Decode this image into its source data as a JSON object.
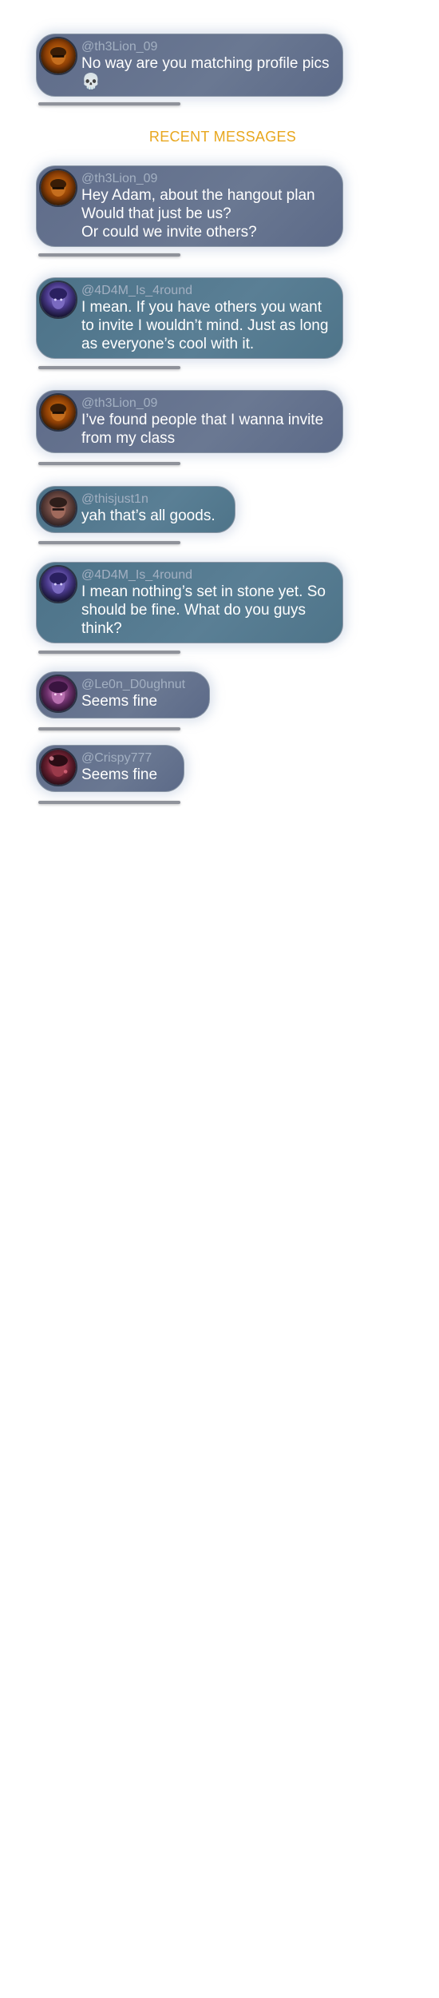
{
  "pinned": {
    "username": "@th3Lion_09",
    "text": "No way are you matching profile pics 💀",
    "avatar": "lion-avatar-icon"
  },
  "section_header": "RECENT MESSAGES",
  "messages": [
    {
      "username": "@th3Lion_09",
      "text": "Hey Adam, about the hangout plan\nWould that just be us?\nOr could we invite others?",
      "avatar": "lion-avatar-icon"
    },
    {
      "username": "@4D4M_Is_4round",
      "text": "I mean. If you have others you want to invite I wouldn’t mind. Just as long as everyone’s cool with it.",
      "avatar": "adam-avatar-icon"
    },
    {
      "username": "@th3Lion_09",
      "text": "I’ve found people that I wanna invite from my class",
      "avatar": "lion-avatar-icon"
    },
    {
      "username": "@thisjust1n",
      "text": "yah that’s all goods.",
      "avatar": "justin-avatar-icon"
    },
    {
      "username": "@4D4M_Is_4round",
      "text": "I mean nothing’s set in stone yet. So should be fine. What do you guys think?",
      "avatar": "adam-avatar-icon"
    },
    {
      "username": "@Le0n_D0ughnut",
      "text": "Seems fine",
      "avatar": "leon-avatar-icon"
    },
    {
      "username": "@Crispy777",
      "text": "Seems fine",
      "avatar": "crispy-avatar-icon"
    }
  ],
  "colors": {
    "header": "#e8a71e",
    "bubble_blue": "#527a90",
    "bubble_slate": "#65738e",
    "username": "#a3b0c2"
  }
}
